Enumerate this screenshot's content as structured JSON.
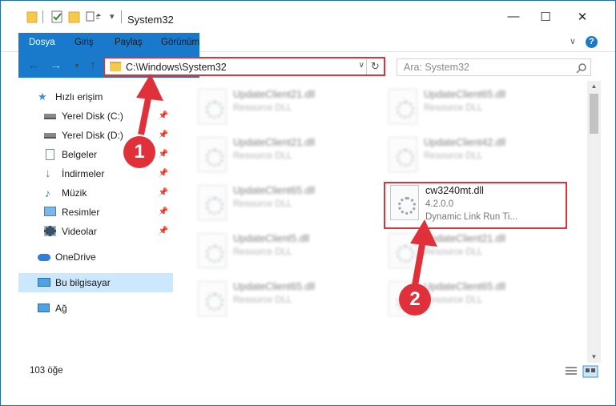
{
  "window": {
    "title": "System32"
  },
  "ribbon": {
    "tabs": [
      "Dosya",
      "Giriş",
      "Paylaş",
      "Görünüm"
    ]
  },
  "address": {
    "path": "C:\\Windows\\System32",
    "search_placeholder": "Ara: System32"
  },
  "nav": {
    "items": [
      {
        "label": "Hızlı erişim",
        "icon": "star-icon"
      },
      {
        "label": "Yerel Disk (C:)",
        "icon": "drive-icon"
      },
      {
        "label": "Yerel Disk (D:)",
        "icon": "drive-icon"
      },
      {
        "label": "Belgeler",
        "icon": "document-icon"
      },
      {
        "label": "İndirmeler",
        "icon": "download-icon"
      },
      {
        "label": "Müzik",
        "icon": "music-icon"
      },
      {
        "label": "Resimler",
        "icon": "picture-icon"
      },
      {
        "label": "Videolar",
        "icon": "video-icon"
      },
      {
        "label": "OneDrive",
        "icon": "cloud-icon"
      },
      {
        "label": "Bu bilgisayar",
        "icon": "computer-icon"
      },
      {
        "label": "Ağ",
        "icon": "network-icon"
      }
    ]
  },
  "files": [
    {
      "name": "UpdateClient21.dll",
      "type": "Resource DLL"
    },
    {
      "name": "UpdateClient65.dll",
      "type": "Resource DLL"
    },
    {
      "name": "UpdateClient21.dll",
      "type": "Resource DLL"
    },
    {
      "name": "UpdateClient42.dll",
      "type": "Resource DLL"
    },
    {
      "name": "UpdateClient65.dll",
      "type": "Resource DLL"
    },
    {
      "name": "cw3240mt.dll",
      "version": "4.2.0.0",
      "type": "Dynamic Link Run Ti..."
    },
    {
      "name": "UpdateClient5.dll",
      "type": "Resource DLL"
    },
    {
      "name": "UpdateClient21.dll",
      "type": "Resource DLL"
    },
    {
      "name": "UpdateClient65.dll",
      "type": "Resource DLL"
    },
    {
      "name": "UpdateClient65.dll",
      "type": "Resource DLL"
    }
  ],
  "status": {
    "count": "103 öğe"
  },
  "callouts": [
    "1",
    "2"
  ],
  "colors": {
    "accent": "#1979ca",
    "highlight": "#d9353a",
    "callout": "#e0313a",
    "selection": "#cce8ff"
  }
}
